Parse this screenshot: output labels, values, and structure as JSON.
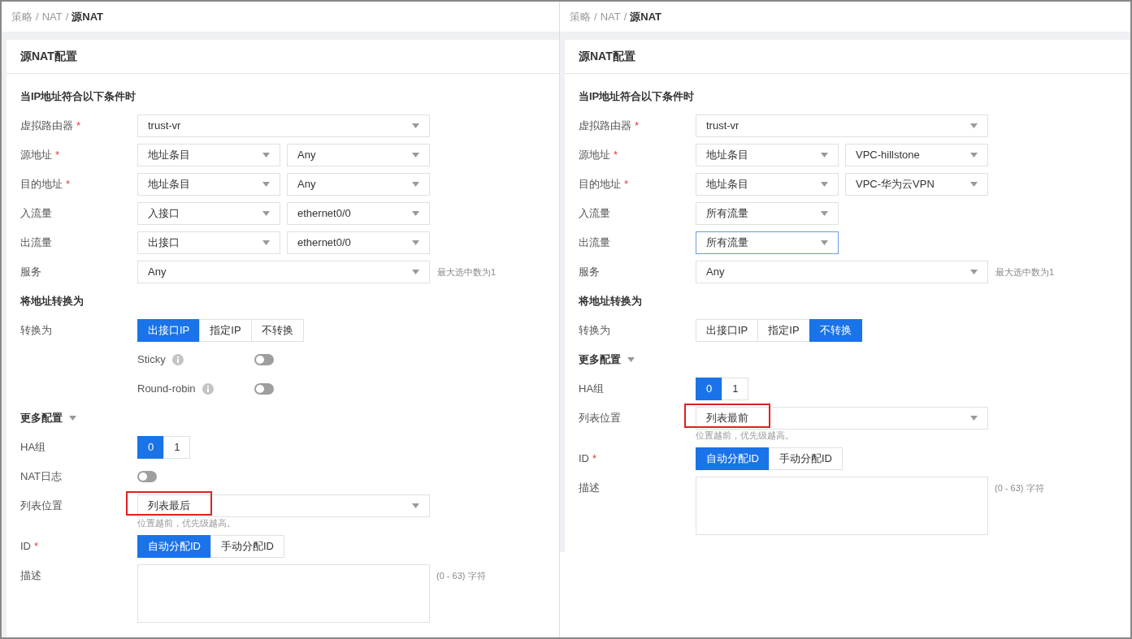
{
  "panels": [
    {
      "breadcrumb": [
        {
          "label": "策略",
          "current": false
        },
        {
          "label": "NAT",
          "current": false
        },
        {
          "label": "源NAT",
          "current": true
        }
      ],
      "separator": "/",
      "title": "源NAT配置",
      "rows": [
        {
          "kind": "heading",
          "text": "当IP地址符合以下条件时"
        },
        {
          "kind": "selects",
          "label": "虚拟路由器",
          "required_mark": "*",
          "selects": [
            {
              "value": "trust-vr",
              "wide": true,
              "focused": false
            }
          ]
        },
        {
          "kind": "selects",
          "label": "源地址",
          "required_mark": "*",
          "selects": [
            {
              "value": "地址条目",
              "wide": false,
              "focused": false
            },
            {
              "value": "Any",
              "wide": false,
              "focused": false
            }
          ]
        },
        {
          "kind": "selects",
          "label": "目的地址",
          "required_mark": "*",
          "selects": [
            {
              "value": "地址条目",
              "wide": false,
              "focused": false
            },
            {
              "value": "Any",
              "wide": false,
              "focused": false
            }
          ]
        },
        {
          "kind": "selects",
          "label": "入流量",
          "selects": [
            {
              "value": "入接口",
              "wide": false,
              "focused": false
            },
            {
              "value": "ethernet0/0",
              "wide": false,
              "focused": false
            }
          ]
        },
        {
          "kind": "selects",
          "label": "出流量",
          "selects": [
            {
              "value": "出接口",
              "wide": false,
              "focused": false
            },
            {
              "value": "ethernet0/0",
              "wide": false,
              "focused": false
            }
          ]
        },
        {
          "kind": "selects",
          "label": "服务",
          "selects": [
            {
              "value": "Any",
              "wide": true,
              "focused": false
            }
          ],
          "note": "最大选中数为1"
        },
        {
          "kind": "heading",
          "text": "将地址转换为"
        },
        {
          "kind": "segmented",
          "label": "转换为",
          "options": [
            {
              "label": "出接口IP",
              "selected": true
            },
            {
              "label": "指定IP",
              "selected": false
            },
            {
              "label": "不转换",
              "selected": false
            }
          ]
        },
        {
          "kind": "suboption",
          "text": "Sticky",
          "on": false
        },
        {
          "kind": "suboption",
          "text": "Round-robin",
          "on": false
        },
        {
          "kind": "heading",
          "text": "更多配置",
          "expanded": true
        },
        {
          "kind": "segmented",
          "label": "HA组",
          "options": [
            {
              "label": "0",
              "selected": true
            },
            {
              "label": "1",
              "selected": false
            }
          ]
        },
        {
          "kind": "switch",
          "label": "NAT日志",
          "on": false
        },
        {
          "kind": "selects",
          "label": "列表位置",
          "selects": [
            {
              "value": "列表最后",
              "wide": true,
              "focused": false,
              "highlighted": true
            }
          ],
          "hint": "位置越前，优先级越高。"
        },
        {
          "kind": "segmented",
          "label": "ID",
          "required_mark": "*",
          "options": [
            {
              "label": "自动分配ID",
              "selected": true
            },
            {
              "label": "手动分配ID",
              "selected": false
            }
          ]
        },
        {
          "kind": "textarea",
          "label": "描述",
          "note": "(0 - 63) 字符"
        }
      ]
    },
    {
      "breadcrumb": [
        {
          "label": "策略",
          "current": false
        },
        {
          "label": "NAT",
          "current": false
        },
        {
          "label": "源NAT",
          "current": true
        }
      ],
      "separator": "/",
      "title": "源NAT配置",
      "rows": [
        {
          "kind": "heading",
          "text": "当IP地址符合以下条件时"
        },
        {
          "kind": "selects",
          "label": "虚拟路由器",
          "required_mark": "*",
          "selects": [
            {
              "value": "trust-vr",
              "wide": true,
              "focused": false
            }
          ]
        },
        {
          "kind": "selects",
          "label": "源地址",
          "required_mark": "*",
          "selects": [
            {
              "value": "地址条目",
              "wide": false,
              "focused": false
            },
            {
              "value": "VPC-hillstone",
              "wide": false,
              "focused": false
            }
          ]
        },
        {
          "kind": "selects",
          "label": "目的地址",
          "required_mark": "*",
          "selects": [
            {
              "value": "地址条目",
              "wide": false,
              "focused": false
            },
            {
              "value": "VPC-华为云VPN",
              "wide": false,
              "focused": false
            }
          ]
        },
        {
          "kind": "selects",
          "label": "入流量",
          "selects": [
            {
              "value": "所有流量",
              "wide": false,
              "focused": false
            }
          ]
        },
        {
          "kind": "selects",
          "label": "出流量",
          "selects": [
            {
              "value": "所有流量",
              "wide": false,
              "focused": true
            }
          ]
        },
        {
          "kind": "selects",
          "label": "服务",
          "selects": [
            {
              "value": "Any",
              "wide": true,
              "focused": false
            }
          ],
          "note": "最大选中数为1"
        },
        {
          "kind": "heading",
          "text": "将地址转换为"
        },
        {
          "kind": "segmented",
          "label": "转换为",
          "options": [
            {
              "label": "出接口IP",
              "selected": false
            },
            {
              "label": "指定IP",
              "selected": false
            },
            {
              "label": "不转换",
              "selected": true
            }
          ]
        },
        {
          "kind": "heading",
          "text": "更多配置",
          "expanded": true
        },
        {
          "kind": "segmented",
          "label": "HA组",
          "options": [
            {
              "label": "0",
              "selected": true
            },
            {
              "label": "1",
              "selected": false
            }
          ]
        },
        {
          "kind": "selects",
          "label": "列表位置",
          "selects": [
            {
              "value": "列表最前",
              "wide": true,
              "focused": false,
              "highlighted": true
            }
          ],
          "hint": "位置越前，优先级越高。"
        },
        {
          "kind": "segmented",
          "label": "ID",
          "required_mark": "*",
          "options": [
            {
              "label": "自动分配ID",
              "selected": true
            },
            {
              "label": "手动分配ID",
              "selected": false
            }
          ]
        },
        {
          "kind": "textarea",
          "label": "描述",
          "note": "(0 - 63) 字符"
        }
      ]
    }
  ]
}
